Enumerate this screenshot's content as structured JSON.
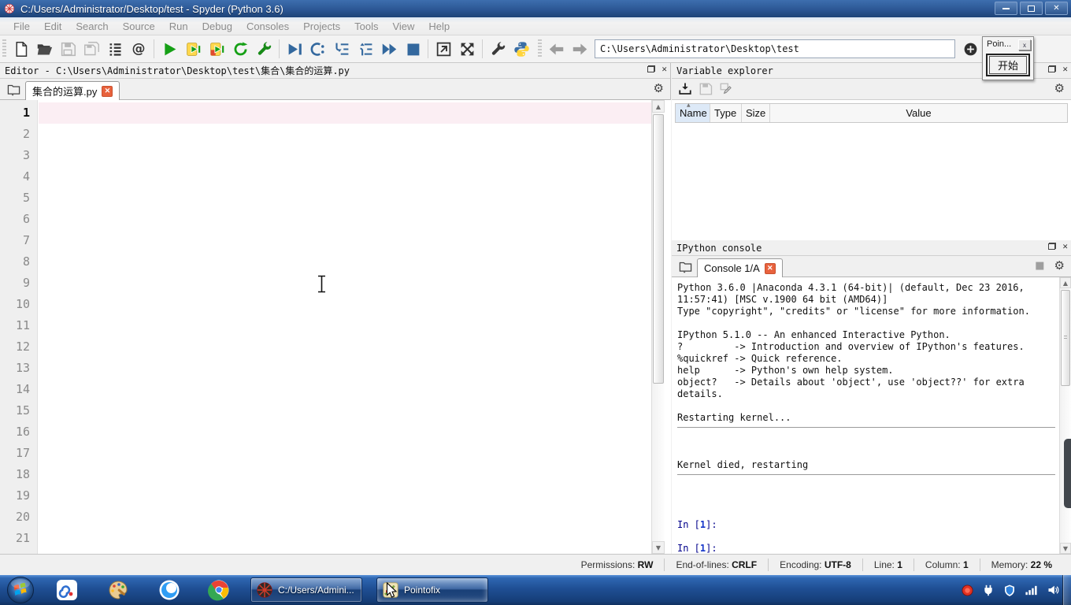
{
  "icons": {
    "gear": "⚙",
    "close_x": "✕",
    "tab_close_x": "✕",
    "at": "@",
    "interrupt_square": "■",
    "sort_asc": "▲",
    "scroll_up": "▲",
    "scroll_down": "▼"
  },
  "window": {
    "title": "C:/Users/Administrator/Desktop/test - Spyder (Python 3.6)"
  },
  "menubar": {
    "items": [
      "File",
      "Edit",
      "Search",
      "Source",
      "Run",
      "Debug",
      "Consoles",
      "Projects",
      "Tools",
      "View",
      "Help"
    ]
  },
  "toolbar": {
    "path_value": "C:\\Users\\Administrator\\Desktop\\test"
  },
  "pointofix": {
    "window_title": "Poin...",
    "close_glyph": "x",
    "start_button": "开始"
  },
  "editor": {
    "panel_title": "Editor - C:\\Users\\Administrator\\Desktop\\test\\集合\\集合的运算.py",
    "tab_label": "集合的运算.py",
    "current_line": "1",
    "line_numbers": [
      "1",
      "2",
      "3",
      "4",
      "5",
      "6",
      "7",
      "8",
      "9",
      "10",
      "11",
      "12",
      "13",
      "14",
      "15",
      "16",
      "17",
      "18",
      "19",
      "20",
      "21"
    ]
  },
  "variable_explorer": {
    "panel_title": "Variable explorer",
    "columns": [
      "Name",
      "Type",
      "Size",
      "Value"
    ]
  },
  "console": {
    "panel_title": "IPython console",
    "tab_label": "Console 1/A",
    "banner": "Python 3.6.0 |Anaconda 4.3.1 (64-bit)| (default, Dec 23 2016,\n11:57:41) [MSC v.1900 64 bit (AMD64)]\nType \"copyright\", \"credits\" or \"license\" for more information.\n\nIPython 5.1.0 -- An enhanced Interactive Python.\n?         -> Introduction and overview of IPython's features.\n%quickref -> Quick reference.\nhelp      -> Python's own help system.\nobject?   -> Details about 'object', use 'object??' for extra\ndetails.",
    "restarting": "Restarting kernel...",
    "kernel_died": "Kernel died, restarting",
    "prompt_in": "In [",
    "prompt_num": "1",
    "prompt_close": "]:"
  },
  "statusbar": {
    "items": [
      {
        "key": "permissions",
        "label": "Permissions",
        "value": "RW"
      },
      {
        "key": "eol",
        "label": "End-of-lines",
        "value": "CRLF"
      },
      {
        "key": "encoding",
        "label": "Encoding",
        "value": "UTF-8"
      },
      {
        "key": "line",
        "label": "Line",
        "value": "1"
      },
      {
        "key": "column",
        "label": "Column",
        "value": "1"
      },
      {
        "key": "memory",
        "label": "Memory",
        "value": "22 %"
      }
    ]
  },
  "taskbar": {
    "spyder_window_label": "C:/Users/Admini...",
    "pointofix_window_label": "Pointofix"
  }
}
